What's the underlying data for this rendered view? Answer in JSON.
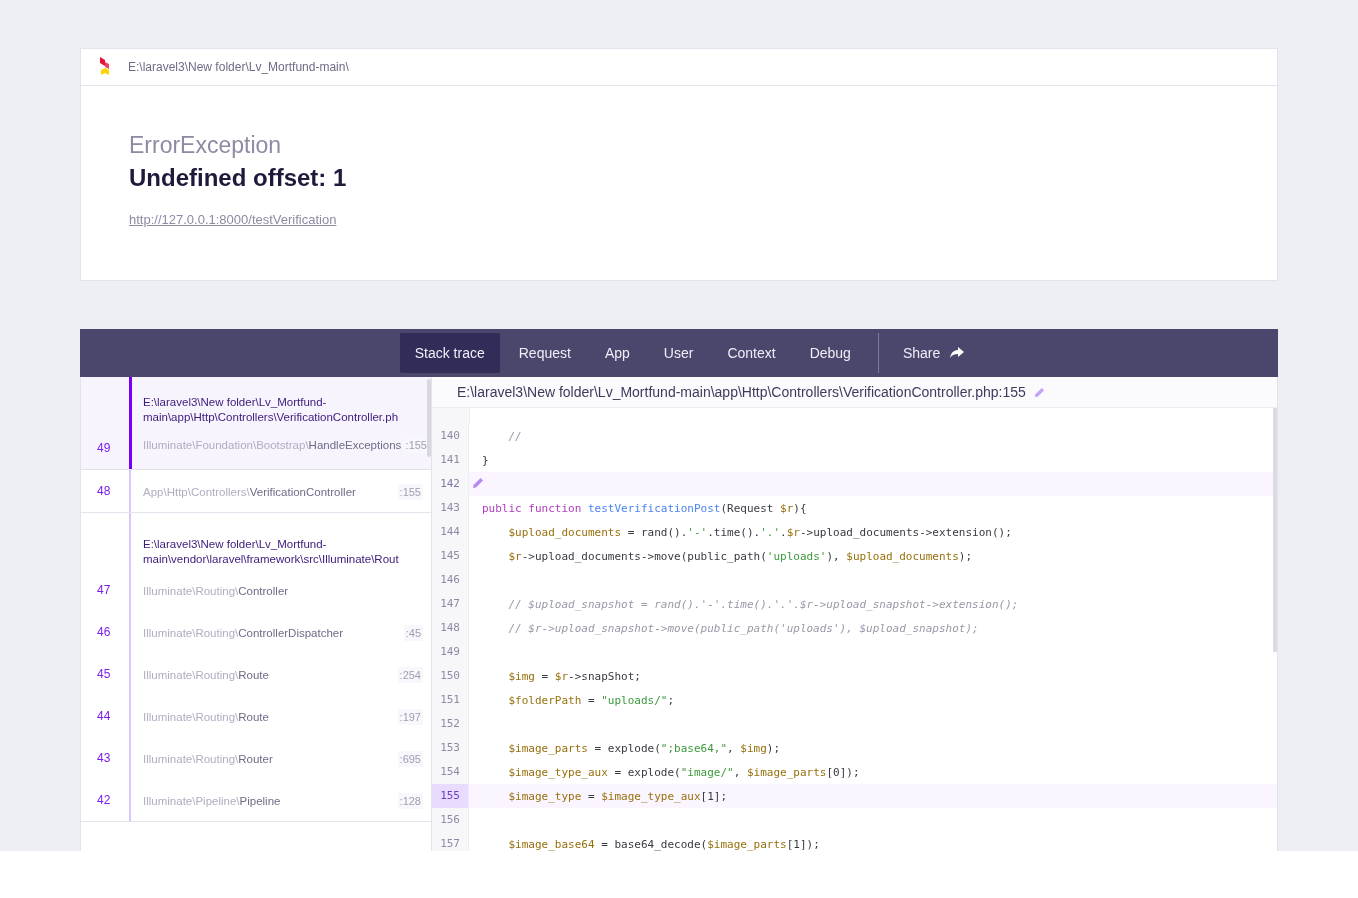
{
  "header": {
    "path": "E:\\laravel3\\New folder\\Lv_Mortfund-main\\"
  },
  "error": {
    "exception": "ErrorException",
    "message": "Undefined offset: 1",
    "url": "http://127.0.0.1:8000/testVerification"
  },
  "tabs": [
    {
      "label": "Stack trace",
      "selected": true
    },
    {
      "label": "Request",
      "selected": false
    },
    {
      "label": "App",
      "selected": false
    },
    {
      "label": "User",
      "selected": false
    },
    {
      "label": "Context",
      "selected": false
    },
    {
      "label": "Debug",
      "selected": false
    }
  ],
  "share": {
    "label": "Share"
  },
  "frame_groups": [
    {
      "frames": [
        {
          "number": "49",
          "selected": true,
          "file": "E:\\laravel3\\New folder\\Lv_Mortfund-main\\app\\Http\\Controllers\\VerificationController.ph",
          "namespace": "Illuminate\\Foundation\\Bootstrap\\",
          "class": "HandleExceptions",
          "line": ":155"
        }
      ]
    },
    {
      "frames": [
        {
          "number": "48",
          "selected": false,
          "namespace": "App\\Http\\Controllers\\",
          "class": "VerificationController",
          "line": ":155"
        }
      ]
    },
    {
      "frames": [
        {
          "number": "47",
          "selected": false,
          "file": "E:\\laravel3\\New folder\\Lv_Mortfund-main\\vendor\\laravel\\framework\\src\\Illuminate\\Rout",
          "namespace": "Illuminate\\Routing\\",
          "class": "Controller"
        },
        {
          "number": "46",
          "selected": false,
          "namespace": "Illuminate\\Routing\\",
          "class": "ControllerDispatcher",
          "line": ":45"
        },
        {
          "number": "45",
          "selected": false,
          "namespace": "Illuminate\\Routing\\",
          "class": "Route",
          "line": ":254"
        },
        {
          "number": "44",
          "selected": false,
          "namespace": "Illuminate\\Routing\\",
          "class": "Route",
          "line": ":197"
        },
        {
          "number": "43",
          "selected": false,
          "namespace": "Illuminate\\Routing\\",
          "class": "Router",
          "line": ":695"
        },
        {
          "number": "42",
          "selected": false,
          "namespace": "Illuminate\\Pipeline\\",
          "class": "Pipeline",
          "line": ":128"
        }
      ]
    }
  ],
  "code": {
    "file": "E:\\laravel3\\New folder\\Lv_Mortfund-main\\app\\Http\\Controllers\\VerificationController.php:155",
    "lines": [
      {
        "number": "140",
        "selected": false,
        "hovered": false,
        "indented": true,
        "tokens": [
          {
            "kind": "comment",
            "text": "//"
          }
        ]
      },
      {
        "number": "141",
        "selected": false,
        "hovered": false,
        "indented": false,
        "tokens": [
          {
            "kind": "plain",
            "text": "}"
          }
        ]
      },
      {
        "number": "142",
        "selected": false,
        "hovered": true
      },
      {
        "number": "143",
        "selected": false,
        "hovered": false,
        "indented": false,
        "tokens": [
          {
            "kind": "keyword",
            "text": "public function"
          },
          {
            "kind": "function",
            "text": "testVerificationPost"
          },
          {
            "kind": "plain",
            "text": "(Request"
          },
          {
            "kind": "variable",
            "text": "$r"
          },
          {
            "kind": "plain",
            "text": "){"
          }
        ]
      },
      {
        "number": "144",
        "selected": false,
        "hovered": false,
        "indented": true,
        "tokens": [
          {
            "kind": "variable",
            "text": "$upload_documents"
          },
          {
            "kind": "plain",
            "text": "= rand()."
          },
          {
            "kind": "string",
            "text": "'-'"
          },
          {
            "kind": "plain",
            "text": ".time()."
          },
          {
            "kind": "string",
            "text": "'.'"
          },
          {
            "kind": "plain",
            "text": "."
          },
          {
            "kind": "variable",
            "text": "$r"
          },
          {
            "kind": "plain",
            "text": "->upload_documents->extension();"
          }
        ]
      },
      {
        "number": "145",
        "selected": false,
        "hovered": false,
        "indented": true,
        "tokens": [
          {
            "kind": "variable",
            "text": "$r"
          },
          {
            "kind": "plain",
            "text": "->upload_documents->move(public_path("
          },
          {
            "kind": "string",
            "text": "'uploads'"
          },
          {
            "kind": "plain",
            "text": "),"
          },
          {
            "kind": "variable",
            "text": "$upload_documents"
          },
          {
            "kind": "plain",
            "text": ");"
          }
        ]
      },
      {
        "number": "146",
        "selected": false,
        "hovered": false
      },
      {
        "number": "147",
        "selected": false,
        "hovered": false,
        "indented": true,
        "tokens": [
          {
            "kind": "comment",
            "text": "// $upload_snapshot = rand().'-'.time().'.'.$r->upload_snapshot->extension();"
          }
        ]
      },
      {
        "number": "148",
        "selected": false,
        "hovered": false,
        "indented": true,
        "tokens": [
          {
            "kind": "comment",
            "text": "// $r->upload_snapshot->move(public_path('uploads'), $upload_snapshot);"
          }
        ]
      },
      {
        "number": "149",
        "selected": false,
        "hovered": false
      },
      {
        "number": "150",
        "selected": false,
        "hovered": false,
        "indented": true,
        "tokens": [
          {
            "kind": "variable",
            "text": "$img"
          },
          {
            "kind": "plain",
            "text": "="
          },
          {
            "kind": "variable",
            "text": "$r"
          },
          {
            "kind": "plain",
            "text": "->snapShot;"
          }
        ]
      },
      {
        "number": "151",
        "selected": false,
        "hovered": false,
        "indented": true,
        "tokens": [
          {
            "kind": "variable",
            "text": "$folderPath"
          },
          {
            "kind": "plain",
            "text": "="
          },
          {
            "kind": "string",
            "text": "\"uploads/\""
          },
          {
            "kind": "plain",
            "text": ";"
          }
        ]
      },
      {
        "number": "152",
        "selected": false,
        "hovered": false
      },
      {
        "number": "153",
        "selected": false,
        "hovered": false,
        "indented": true,
        "tokens": [
          {
            "kind": "variable",
            "text": "$image_parts"
          },
          {
            "kind": "plain",
            "text": "= explode("
          },
          {
            "kind": "string",
            "text": "\";base64,\""
          },
          {
            "kind": "plain",
            "text": ","
          },
          {
            "kind": "variable",
            "text": "$img"
          },
          {
            "kind": "plain",
            "text": ");"
          }
        ]
      },
      {
        "number": "154",
        "selected": false,
        "hovered": false,
        "indented": true,
        "tokens": [
          {
            "kind": "variable",
            "text": "$image_type_aux"
          },
          {
            "kind": "plain",
            "text": "= explode("
          },
          {
            "kind": "string",
            "text": "\"image/\""
          },
          {
            "kind": "plain",
            "text": ","
          },
          {
            "kind": "variable",
            "text": "$image_parts"
          },
          {
            "kind": "plain",
            "text": "[0]);"
          }
        ]
      },
      {
        "number": "155",
        "selected": true,
        "hovered": false,
        "indented": true,
        "tokens": [
          {
            "kind": "variable",
            "text": "$image_type"
          },
          {
            "kind": "plain",
            "text": "="
          },
          {
            "kind": "variable",
            "text": "$image_type_aux"
          },
          {
            "kind": "plain",
            "text": "[1];"
          }
        ]
      },
      {
        "number": "156",
        "selected": false,
        "hovered": false
      },
      {
        "number": "157",
        "selected": false,
        "hovered": false,
        "indented": true,
        "tokens": [
          {
            "kind": "variable",
            "text": "$image_base64"
          },
          {
            "kind": "plain",
            "text": "= base64_decode("
          },
          {
            "kind": "variable",
            "text": "$image_parts"
          },
          {
            "kind": "plain",
            "text": "[1]);"
          }
        ]
      }
    ]
  }
}
